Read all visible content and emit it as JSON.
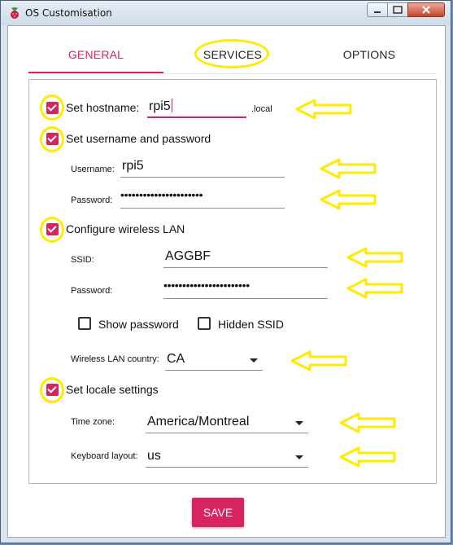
{
  "window": {
    "title": "OS Customisation"
  },
  "tabs": [
    {
      "label": "GENERAL"
    },
    {
      "label": "SERVICES"
    },
    {
      "label": "OPTIONS"
    }
  ],
  "general": {
    "hostname": {
      "label": "Set hostname:",
      "value": "rpi5",
      "suffix": ".local",
      "checked": true
    },
    "user": {
      "label": "Set username and password",
      "checked": true,
      "username_label": "Username:",
      "username_value": "rpi5",
      "password_label": "Password:",
      "password_value": "••••••••••••••••••••••"
    },
    "wifi": {
      "label": "Configure wireless LAN",
      "checked": true,
      "ssid_label": "SSID:",
      "ssid_value": "AGGBF",
      "password_label": "Password:",
      "password_value": "•••••••••••••••••••••••",
      "show_password_label": "Show password",
      "show_password_checked": false,
      "hidden_ssid_label": "Hidden SSID",
      "hidden_ssid_checked": false,
      "country_label": "Wireless LAN country:",
      "country_value": "CA"
    },
    "locale": {
      "label": "Set locale settings",
      "checked": true,
      "timezone_label": "Time zone:",
      "timezone_value": "America/Montreal",
      "keyboard_label": "Keyboard layout:",
      "keyboard_value": "us"
    }
  },
  "save_label": "SAVE",
  "colors": {
    "accent": "#d6245f",
    "annotation": "#ffea00"
  }
}
